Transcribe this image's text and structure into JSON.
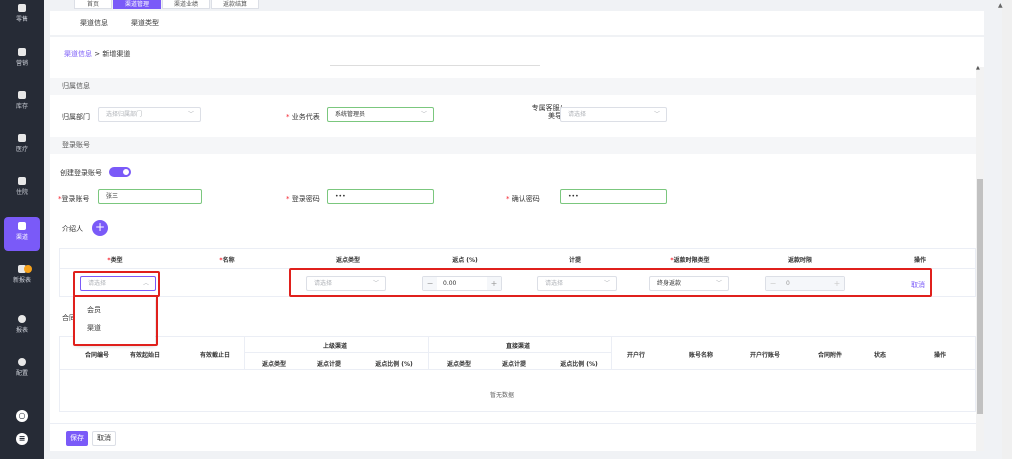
{
  "sidebar": {
    "items": [
      {
        "label": "零售"
      },
      {
        "label": "营销"
      },
      {
        "label": "库存"
      },
      {
        "label": "医疗"
      },
      {
        "label": "住院"
      },
      {
        "label": "渠道"
      },
      {
        "label": "新报表"
      },
      {
        "label": "报表"
      },
      {
        "label": "配置"
      }
    ],
    "bottom_icons": [
      "search-icon",
      "menu-icon"
    ],
    "accent": "#7a5af8",
    "badge_color": "#f7a21b"
  },
  "tabs": [
    "首页",
    "渠道管理",
    "渠道业绩",
    "返款结算"
  ],
  "subnav": [
    "渠道信息",
    "渠道类型"
  ],
  "breadcrumb": {
    "parent": "渠道信息",
    "sep": " > ",
    "current": "新增渠道"
  },
  "sections": {
    "belong": "归属信息",
    "login": "登录账号",
    "contract": "合同"
  },
  "belong": {
    "dept_label": "归属部门",
    "dept_placeholder": "选择归属部门",
    "biz_label": "业务代表",
    "biz_value": "系统管理员",
    "cs_label": "专属客服/",
    "cs_label2": "美导",
    "cs_placeholder": "请选择"
  },
  "login": {
    "create_label": "创建登录账号",
    "account_label": "登录账号",
    "account_value": "张三",
    "pwd_label": "登录密码",
    "pwd_value": "•••",
    "confirm_label": "确认密码",
    "confirm_value": "•••"
  },
  "introducer": {
    "label": "介绍人",
    "add": "+"
  },
  "intro_table": {
    "headers": [
      "类型",
      "名称",
      "返点类型",
      "返点 (%)",
      "计提",
      "返款时限类型",
      "返款时限",
      "操作"
    ],
    "row": {
      "type_placeholder": "请选择",
      "rebate_type_placeholder": "请选择",
      "rebate_pct": "0.00",
      "accrual_placeholder": "请选择",
      "period_type": "终身返款",
      "period": "0",
      "action": "取消"
    }
  },
  "dropdown": {
    "options": [
      "会员",
      "渠道"
    ]
  },
  "contract_table": {
    "headers": [
      "合同编号",
      "有效起始日",
      "有效截止日",
      "开户行",
      "账号名称",
      "开户行账号",
      "合同附件",
      "状态",
      "操作"
    ],
    "group_up": "上级渠道",
    "group_direct": "直接渠道",
    "sub": [
      "返点类型",
      "返点计提",
      "返点比例 (%)"
    ],
    "empty": "暂无数据"
  },
  "footer": {
    "save": "保存",
    "cancel": "取消"
  }
}
